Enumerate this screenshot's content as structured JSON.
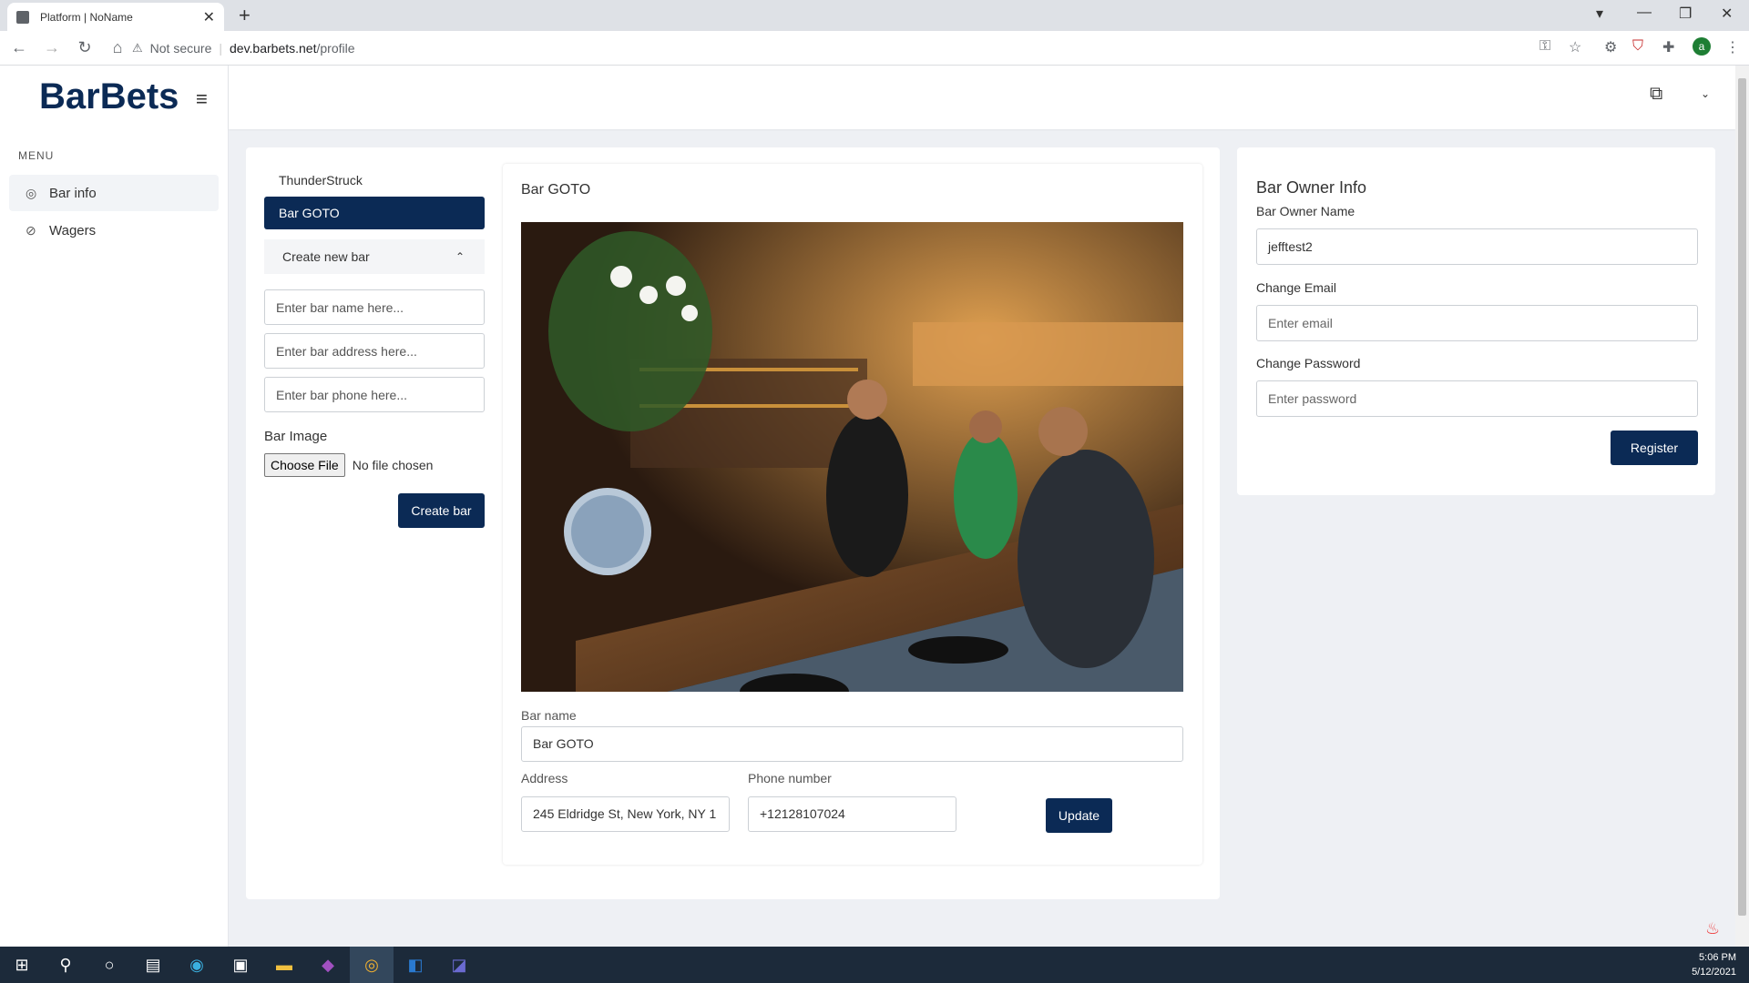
{
  "browser": {
    "tab_title": "Platform | NoName",
    "security_label": "Not secure",
    "url_host": "dev.barbets.net",
    "url_path": "/profile",
    "avatar_letter": "a"
  },
  "sidebar": {
    "logo": "BarBets",
    "menu_header": "MENU",
    "items": [
      {
        "label": "Bar info",
        "icon": "map-pin-icon"
      },
      {
        "label": "Wagers",
        "icon": "tag-icon"
      }
    ]
  },
  "bars": {
    "items": [
      "ThunderStruck",
      "Bar GOTO"
    ],
    "selected": "Bar GOTO",
    "create_toggle_label": "Create new bar",
    "name_placeholder": "Enter bar name here...",
    "address_placeholder": "Enter bar address here...",
    "phone_placeholder": "Enter bar phone here...",
    "image_label": "Bar Image",
    "choose_file_label": "Choose File",
    "no_file_label": "No file chosen",
    "create_button": "Create bar"
  },
  "detail": {
    "title": "Bar GOTO",
    "name_label": "Bar name",
    "name_value": "Bar GOTO",
    "address_label": "Address",
    "address_value": "245 Eldridge St, New York, NY 1",
    "phone_label": "Phone number",
    "phone_value": "+12128107024",
    "update_button": "Update"
  },
  "owner": {
    "title": "Bar Owner Info",
    "name_label": "Bar Owner Name",
    "name_value": "jefftest2",
    "email_label": "Change Email",
    "email_placeholder": "Enter email",
    "password_label": "Change Password",
    "password_placeholder": "Enter password",
    "register_button": "Register"
  },
  "taskbar": {
    "time": "5:06 PM",
    "date": "5/12/2021"
  },
  "colors": {
    "primary": "#0b2a55",
    "background": "#eef0f4"
  }
}
